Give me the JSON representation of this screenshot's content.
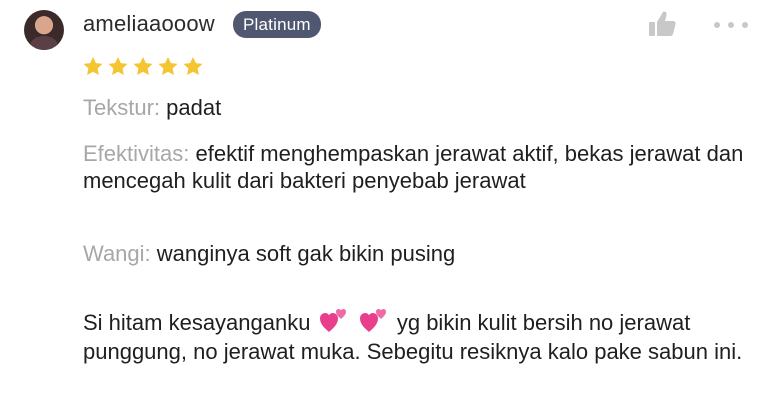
{
  "user": {
    "username": "ameliaaooow",
    "badge": "Platinum"
  },
  "rating": {
    "stars": 5,
    "max": 5,
    "color": "#f5c431"
  },
  "fields": [
    {
      "label": "Tekstur:",
      "value": " padat"
    },
    {
      "label": "Efektivitas:",
      "value": " efektif menghempaskan jerawat aktif, bekas jerawat dan mencegah kulit dari bakteri penyebab jerawat"
    },
    {
      "label": "Wangi:",
      "value": " wanginya soft gak bikin pusing"
    }
  ],
  "review": {
    "part1": "Si hitam kesayanganku",
    "part2": "yg bikin kulit bersih no jerawat punggung, no jerawat muka. Sebegitu resiknya kalo pake sabun ini.",
    "emoji": "two-hearts-icon"
  },
  "icons": {
    "like": "thumbs-up-icon",
    "more": "more-options-icon"
  },
  "colors": {
    "badge_bg": "#4f5870",
    "label_gray": "#a7a7a7",
    "heart_pink": "#e83e8c"
  }
}
